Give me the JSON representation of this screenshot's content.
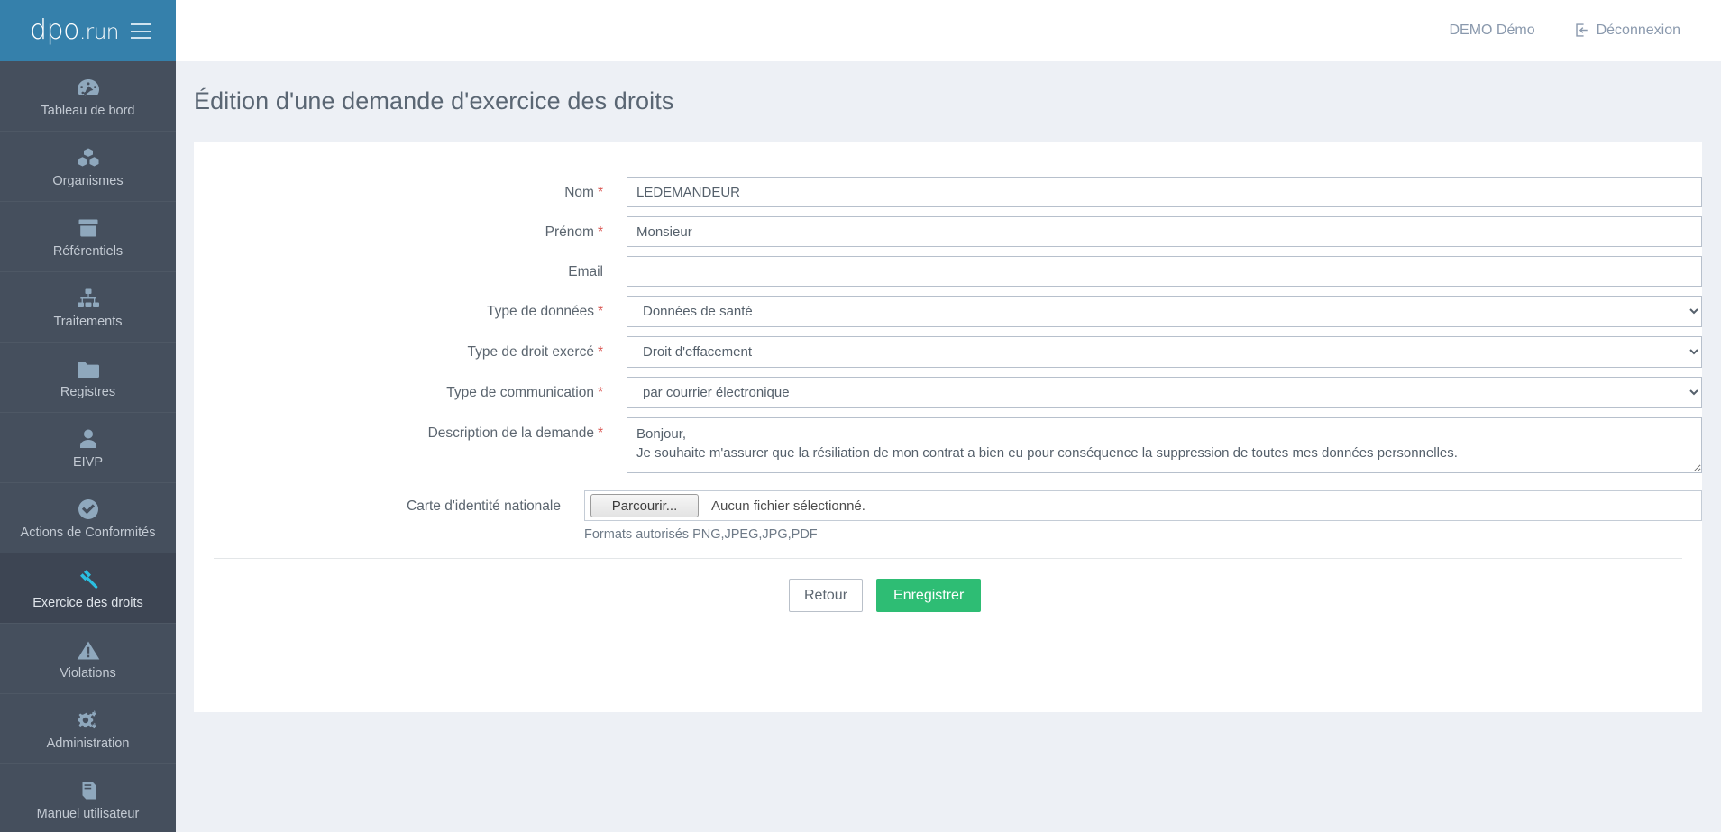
{
  "brand": {
    "name": "dpo",
    "suffix": ".run",
    "menu_icon": "hamburger-icon"
  },
  "topbar": {
    "user": "DEMO Démo",
    "logout_label": "Déconnexion",
    "logout_icon": "sign-out-icon"
  },
  "page": {
    "title": "Édition d'une demande d'exercice des droits"
  },
  "sidebar": {
    "items": [
      {
        "label": "Tableau de bord",
        "icon": "dashboard-gauge-icon",
        "active": false
      },
      {
        "label": "Organismes",
        "icon": "cubes-icon",
        "active": false
      },
      {
        "label": "Référentiels",
        "icon": "archive-box-icon",
        "active": false
      },
      {
        "label": "Traitements",
        "icon": "sitemap-icon",
        "active": false
      },
      {
        "label": "Registres",
        "icon": "folder-icon",
        "active": false
      },
      {
        "label": "EIVP",
        "icon": "user-icon",
        "active": false
      },
      {
        "label": "Actions de Conformités",
        "icon": "check-circle-icon",
        "active": false
      },
      {
        "label": "Exercice des droits",
        "icon": "gavel-icon",
        "active": true
      },
      {
        "label": "Violations",
        "icon": "warning-triangle-icon",
        "active": false
      },
      {
        "label": "Administration",
        "icon": "gears-icon",
        "active": false
      },
      {
        "label": "Manuel utilisateur",
        "icon": "book-icon",
        "active": false
      }
    ]
  },
  "form": {
    "required_marker": "*",
    "fields": {
      "nom": {
        "label": "Nom",
        "value": "LEDEMANDEUR",
        "placeholder": ""
      },
      "prenom": {
        "label": "Prénom",
        "value": "Monsieur",
        "placeholder": ""
      },
      "email": {
        "label": "Email",
        "value": "",
        "placeholder": ""
      },
      "type_donnees": {
        "label": "Type de données",
        "value": "Données de santé"
      },
      "type_droit": {
        "label": "Type de droit exercé",
        "value": "Droit d'effacement"
      },
      "type_communication": {
        "label": "Type de communication",
        "value": "par courrier électronique"
      },
      "description": {
        "label": "Description de la demande",
        "value": "Bonjour,\nJe souhaite m'assurer que la résiliation de mon contrat a bien eu pour conséquence la suppression de toutes mes données personnelles."
      },
      "carte_identite": {
        "label": "Carte d'identité nationale",
        "browse_label": "Parcourir...",
        "file_status": "Aucun fichier sélectionné.",
        "hint": "Formats autorisés PNG,JPEG,JPG,PDF"
      }
    },
    "buttons": {
      "back": "Retour",
      "save": "Enregistrer"
    }
  },
  "colors": {
    "brand_blue": "#3580ab",
    "sidebar": "#454f5d",
    "sidebar_active": "#3d4553",
    "save_green": "#2ebd74",
    "required_red": "#d9534f",
    "page_bg": "#edf0f5"
  }
}
